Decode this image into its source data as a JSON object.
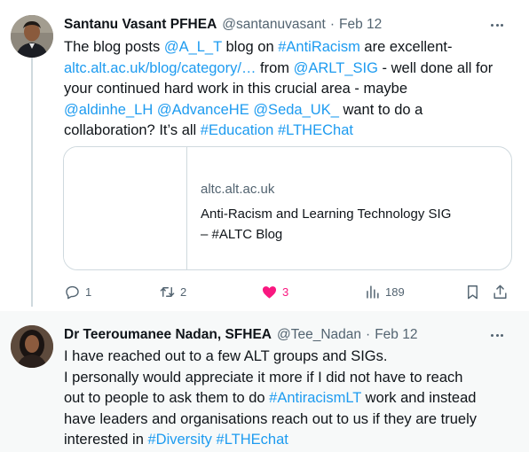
{
  "tweet1": {
    "author_name": "Santanu Vasant PFHEA",
    "handle": "@santanuvasant",
    "separator": "·",
    "date": "Feb 12",
    "line1": {
      "t1": "The blog posts ",
      "m1": "@A_L_T",
      "t2": " blog on ",
      "h1": "#AntiRacism",
      "t3": " are excellent-"
    },
    "line2": {
      "url": "altc.alt.ac.uk/blog/category/…",
      "t1": " from ",
      "m1": "@ARLT_SIG",
      "t2": " - well done all for"
    },
    "line3": {
      "t1": "your continued hard work in this crucial area - maybe"
    },
    "line4": {
      "m1": "@aldinhe_LH",
      "s1": " ",
      "m2": "@AdvanceHE",
      "s2": " ",
      "m3": "@Seda_UK_",
      "t1": " want to do a"
    },
    "line5": {
      "t1": "collaboration? It’s all ",
      "h1": "#Education",
      "s1": " ",
      "h2": "#LTHEChat"
    },
    "card": {
      "domain": "altc.alt.ac.uk",
      "title_line1": "Anti-Racism and Learning Technology SIG",
      "title_line2": "– #ALTC Blog"
    },
    "actions": {
      "replies": "1",
      "retweets": "2",
      "likes": "3",
      "views": "189"
    }
  },
  "tweet2": {
    "author_name": "Dr Teeroumanee Nadan, SFHEA",
    "handle": "@Tee_Nadan",
    "separator": "·",
    "date": "Feb 12",
    "line1": {
      "t1": "I have reached out to a few ALT groups and SIGs."
    },
    "line2": {
      "t1": "I personally would appreciate it more if I did not have to reach"
    },
    "line3": {
      "t1": "out to people to ask them to do ",
      "h1": "#AntiracismLT",
      "t2": " work and instead"
    },
    "line4": {
      "t1": "have leaders and organisations reach out to us if they are truely"
    },
    "line5": {
      "t1": "interested in ",
      "h1": "#Diversity",
      "s1": " ",
      "h2": "#LTHEchat"
    }
  },
  "colors": {
    "link": "#1d9bf0",
    "like": "#f91880",
    "muted": "#536471",
    "border": "#cfd9de"
  },
  "icons": [
    "more-icon",
    "reply-icon",
    "retweet-icon",
    "like-icon",
    "views-icon",
    "bookmark-icon",
    "share-icon"
  ]
}
